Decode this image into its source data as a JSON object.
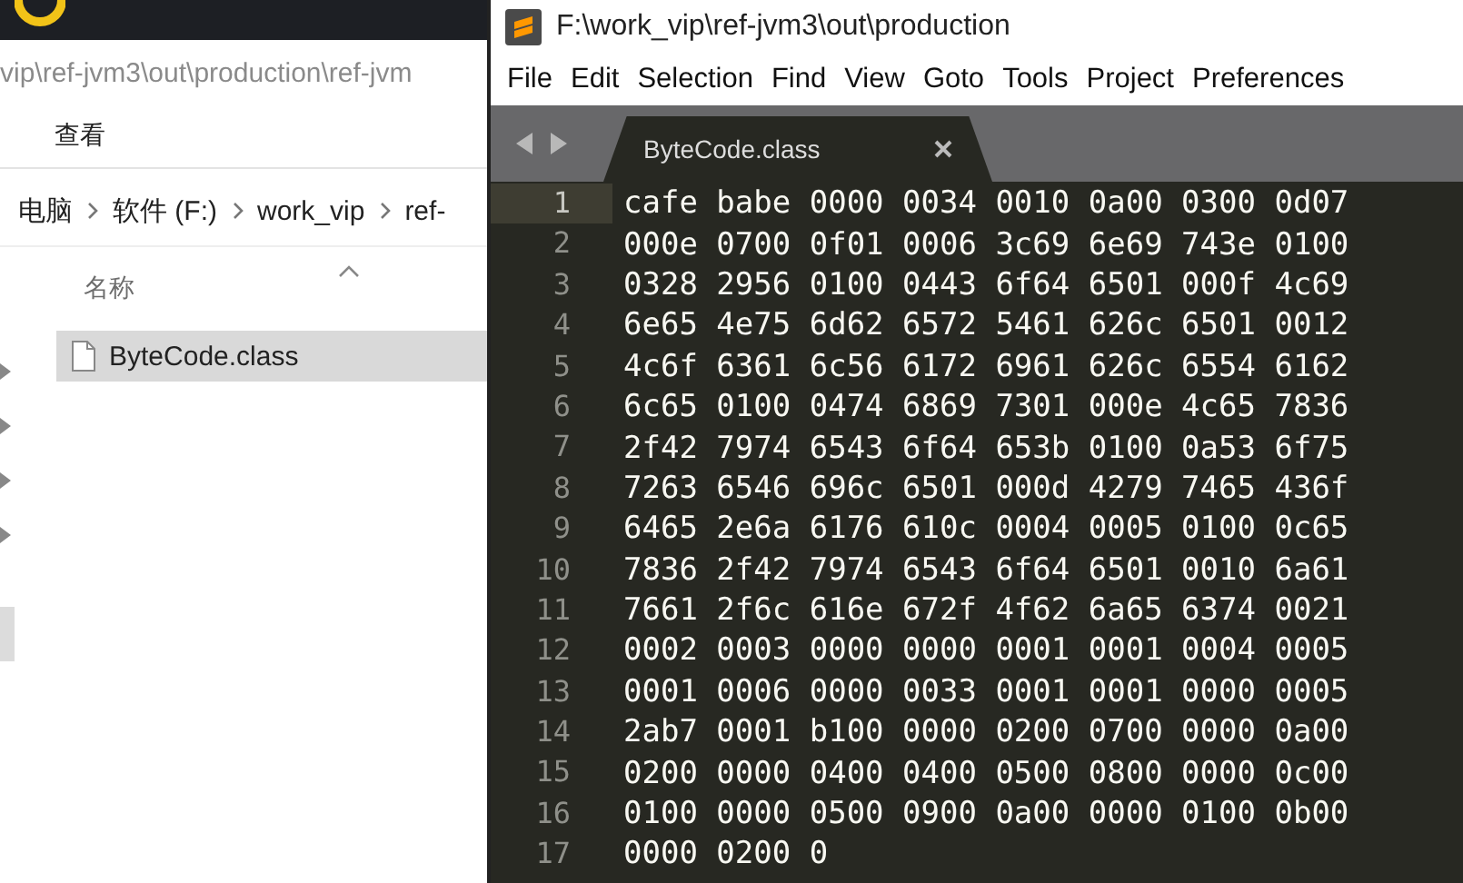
{
  "explorer": {
    "address": "vip\\ref-jvm3\\out\\production\\ref-jvm",
    "ribbon_tabs": [
      "查看"
    ],
    "breadcrumb": [
      "电脑",
      "软件 (F:)",
      "work_vip",
      "ref-"
    ],
    "column_header": "名称",
    "files": [
      {
        "name": "ByteCode.class",
        "selected": true
      }
    ]
  },
  "editor": {
    "title": "F:\\work_vip\\ref-jvm3\\out\\production",
    "menu": [
      "File",
      "Edit",
      "Selection",
      "Find",
      "View",
      "Goto",
      "Tools",
      "Project",
      "Preferences"
    ],
    "tabs": [
      {
        "label": "ByteCode.class",
        "selected": true
      }
    ],
    "lines": [
      {
        "number": "1",
        "text": "cafe babe 0000 0034 0010 0a00 0300 0d07",
        "current": true
      },
      {
        "number": "2",
        "text": "000e 0700 0f01 0006 3c69 6e69 743e 0100",
        "current": false
      },
      {
        "number": "3",
        "text": "0328 2956 0100 0443 6f64 6501 000f 4c69",
        "current": false
      },
      {
        "number": "4",
        "text": "6e65 4e75 6d62 6572 5461 626c 6501 0012",
        "current": false
      },
      {
        "number": "5",
        "text": "4c6f 6361 6c56 6172 6961 626c 6554 6162",
        "current": false
      },
      {
        "number": "6",
        "text": "6c65 0100 0474 6869 7301 000e 4c65 7836",
        "current": false
      },
      {
        "number": "7",
        "text": "2f42 7974 6543 6f64 653b 0100 0a53 6f75",
        "current": false
      },
      {
        "number": "8",
        "text": "7263 6546 696c 6501 000d 4279 7465 436f",
        "current": false
      },
      {
        "number": "9",
        "text": "6465 2e6a 6176 610c 0004 0005 0100 0c65",
        "current": false
      },
      {
        "number": "10",
        "text": "7836 2f42 7974 6543 6f64 6501 0010 6a61",
        "current": false
      },
      {
        "number": "11",
        "text": "7661 2f6c 616e 672f 4f62 6a65 6374 0021",
        "current": false
      },
      {
        "number": "12",
        "text": "0002 0003 0000 0000 0001 0001 0004 0005",
        "current": false
      },
      {
        "number": "13",
        "text": "0001 0006 0000 0033 0001 0001 0000 0005",
        "current": false
      },
      {
        "number": "14",
        "text": "2ab7 0001 b100 0000 0200 0700 0000 0a00",
        "current": false
      },
      {
        "number": "15",
        "text": "0200 0000 0400 0400 0500 0800 0000 0c00",
        "current": false
      },
      {
        "number": "16",
        "text": "0100 0000 0500 0900 0a00 0000 0100 0b00",
        "current": false
      },
      {
        "number": "17",
        "text": "0000 0200 0",
        "current": false
      }
    ]
  }
}
